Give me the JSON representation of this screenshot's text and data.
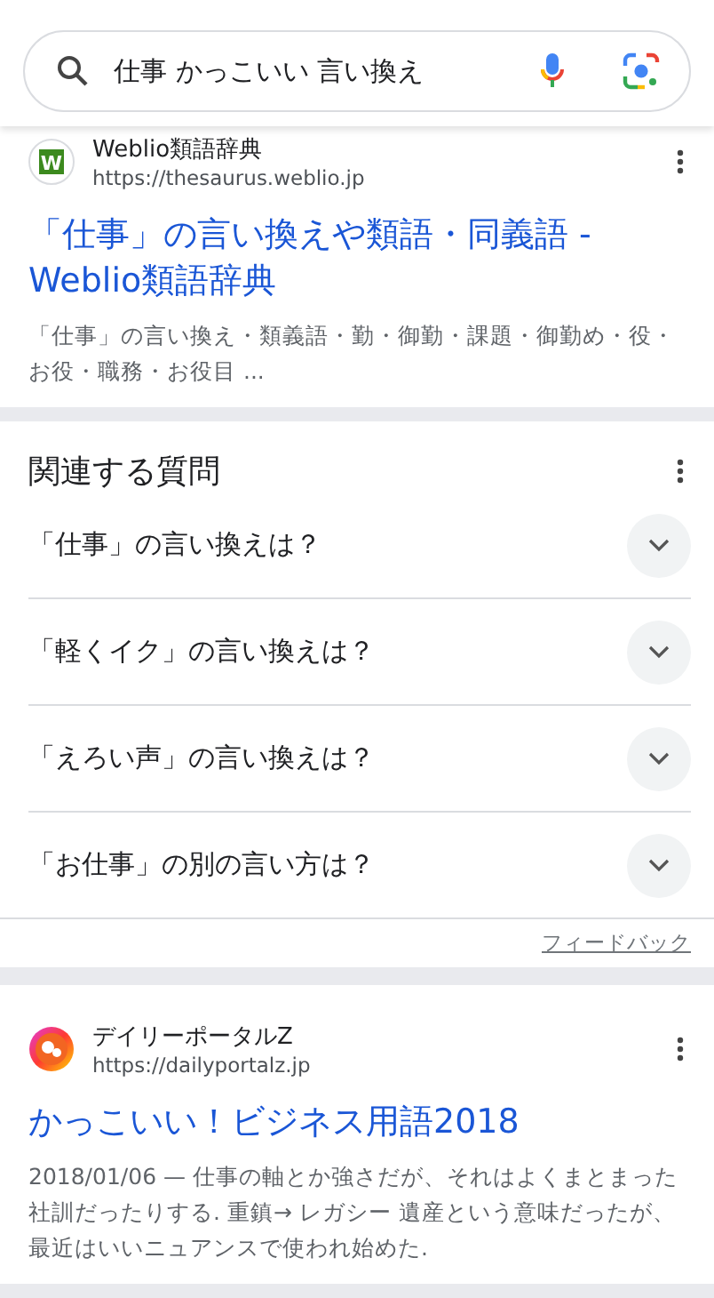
{
  "search": {
    "value": "仕事 かっこいい 言い換え"
  },
  "results": [
    {
      "site": "Weblio類語辞典",
      "url": "https://thesaurus.weblio.jp",
      "favicon": {
        "kind": "letter",
        "text": "W"
      },
      "title": "「仕事」の言い換えや類語・同義語 - Weblio類語辞典",
      "snippet": "「仕事」の言い換え・類義語・勤・御勤・課題・御勤め・役・お役・職務・お役目 ..."
    }
  ],
  "related": {
    "title": "関連する質問",
    "questions": [
      {
        "text": "「仕事」の言い換えは？",
        "expanded": false
      },
      {
        "text": "「軽くイク」の言い換えは？",
        "expanded": false
      },
      {
        "text": "「えろい声」の言い換えは？",
        "expanded": false
      },
      {
        "text": "「お仕事」の別の言い方は？",
        "expanded": false
      }
    ],
    "feedback": "フィードバック"
  },
  "results_after": [
    {
      "site": "デイリーポータルZ",
      "url": "https://dailyportalz.jp",
      "favicon": {
        "kind": "ring"
      },
      "title": "かっこいい！ビジネス用語2018",
      "snippet": "2018/01/06 — 仕事の軸とか強さだが、それはよくまとまった社訓だったりする. 重鎮→ レガシー 遺産という意味だったが、最近はいいニュアンスで使われ始めた."
    }
  ]
}
